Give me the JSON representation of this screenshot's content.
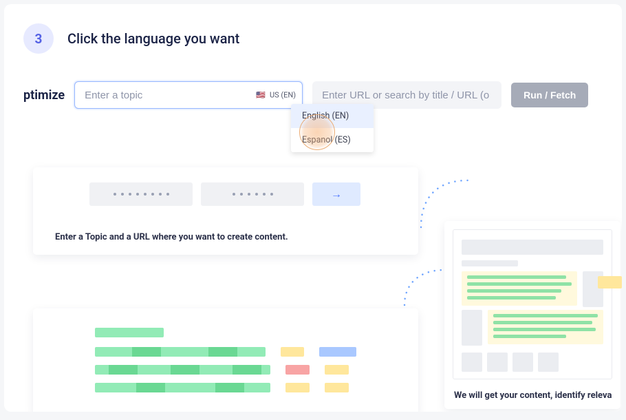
{
  "step": {
    "number": "3",
    "title": "Click the language you want"
  },
  "label_left": "ptimize",
  "topic_input": {
    "placeholder": "Enter a topic",
    "lang_chip_flag": "🇺🇸",
    "lang_chip_text": "US (EN)"
  },
  "url_input": {
    "placeholder": "Enter URL or search by title / URL (o"
  },
  "run_button": "Run / Fetch",
  "lang_menu": {
    "items": [
      {
        "label": "English (EN)",
        "active": true
      },
      {
        "label": "Espanol (ES)",
        "active": false
      }
    ]
  },
  "preview1": {
    "arrow": "→",
    "caption": "Enter a Topic and a URL where you want to create content."
  },
  "preview3": {
    "caption": "We will get your content, identify releva"
  }
}
